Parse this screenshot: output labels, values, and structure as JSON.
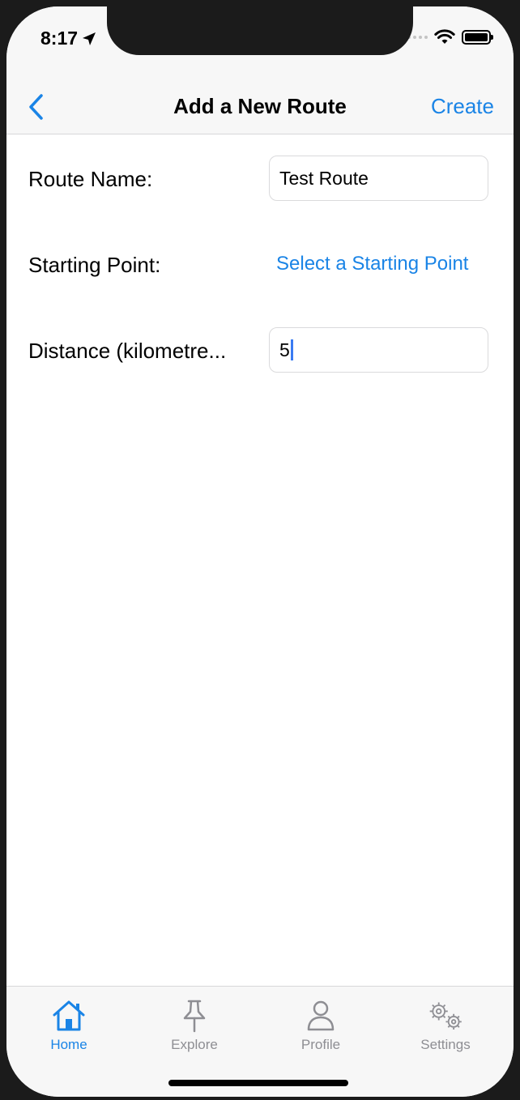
{
  "status_bar": {
    "time": "8:17"
  },
  "nav": {
    "title": "Add a New Route",
    "create_label": "Create"
  },
  "form": {
    "route_name_label": "Route Name:",
    "route_name_value": "Test Route",
    "starting_point_label": "Starting Point:",
    "starting_point_button": "Select a Starting Point",
    "distance_label": "Distance (kilometre...",
    "distance_value": "5"
  },
  "tabs": [
    {
      "label": "Home",
      "icon": "home-icon",
      "active": true
    },
    {
      "label": "Explore",
      "icon": "pin-icon",
      "active": false
    },
    {
      "label": "Profile",
      "icon": "person-icon",
      "active": false
    },
    {
      "label": "Settings",
      "icon": "gears-icon",
      "active": false
    }
  ],
  "colors": {
    "accent": "#1a84e6",
    "inactive": "#8e8e93"
  }
}
